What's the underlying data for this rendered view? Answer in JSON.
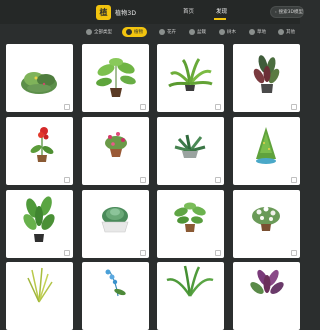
{
  "app": {
    "logo_text": "植物3D",
    "logo_badge": "植"
  },
  "nav": {
    "items": [
      {
        "label": "首页"
      },
      {
        "label": "发现"
      }
    ],
    "search_placeholder": "搜索3D模型"
  },
  "categories": [
    {
      "label": "全部类型",
      "icon": "grid-icon"
    },
    {
      "label": "植物",
      "icon": "plant-icon",
      "active": true
    },
    {
      "label": "花卉",
      "icon": "flower-icon"
    },
    {
      "label": "盆栽",
      "icon": "pot-icon"
    },
    {
      "label": "树木",
      "icon": "tree-icon"
    },
    {
      "label": "草地",
      "icon": "grass-icon"
    },
    {
      "label": "其他",
      "icon": "more-icon"
    }
  ],
  "cards": [
    {
      "name": "leafy-bush"
    },
    {
      "name": "pothos-plant"
    },
    {
      "name": "fern-plant"
    },
    {
      "name": "rubber-plant"
    },
    {
      "name": "red-flower"
    },
    {
      "name": "flowering-pot"
    },
    {
      "name": "succulent-tray"
    },
    {
      "name": "cone-topiary"
    },
    {
      "name": "tall-leaf-plant"
    },
    {
      "name": "aloe-bowl"
    },
    {
      "name": "leafy-pot"
    },
    {
      "name": "white-flower-bush"
    },
    {
      "name": "grass-plant"
    },
    {
      "name": "blue-orchid"
    },
    {
      "name": "palm-plant"
    },
    {
      "name": "purple-bush"
    }
  ],
  "colors": {
    "accent": "#f2c40f",
    "background": "#2b2e2e",
    "card": "#ffffff"
  }
}
